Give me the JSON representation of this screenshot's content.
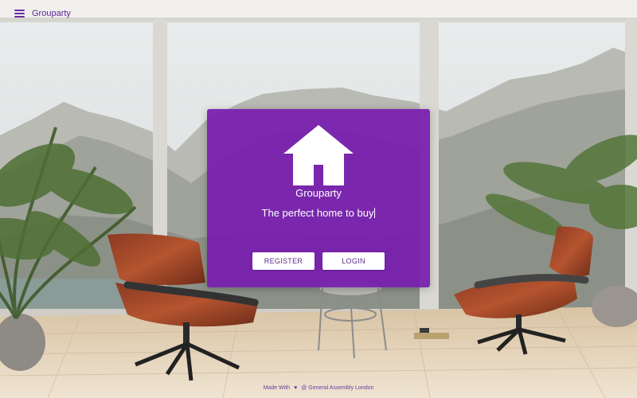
{
  "header": {
    "brand": "Grouparty"
  },
  "hero": {
    "title": "Grouparty",
    "tagline": "The perfect home to buy",
    "register_label": "REGISTER",
    "login_label": "LOGIN"
  },
  "footer": {
    "made_with": "Made With",
    "credit": "@ General Assembly London"
  },
  "colors": {
    "brand_purple": "#761caf",
    "button_text": "#5b2a86",
    "background_scene": "mountain-lounge-photo"
  },
  "icons": {
    "menu": "hamburger-menu-icon",
    "logo": "house-icon",
    "footer": "heart-icon"
  }
}
